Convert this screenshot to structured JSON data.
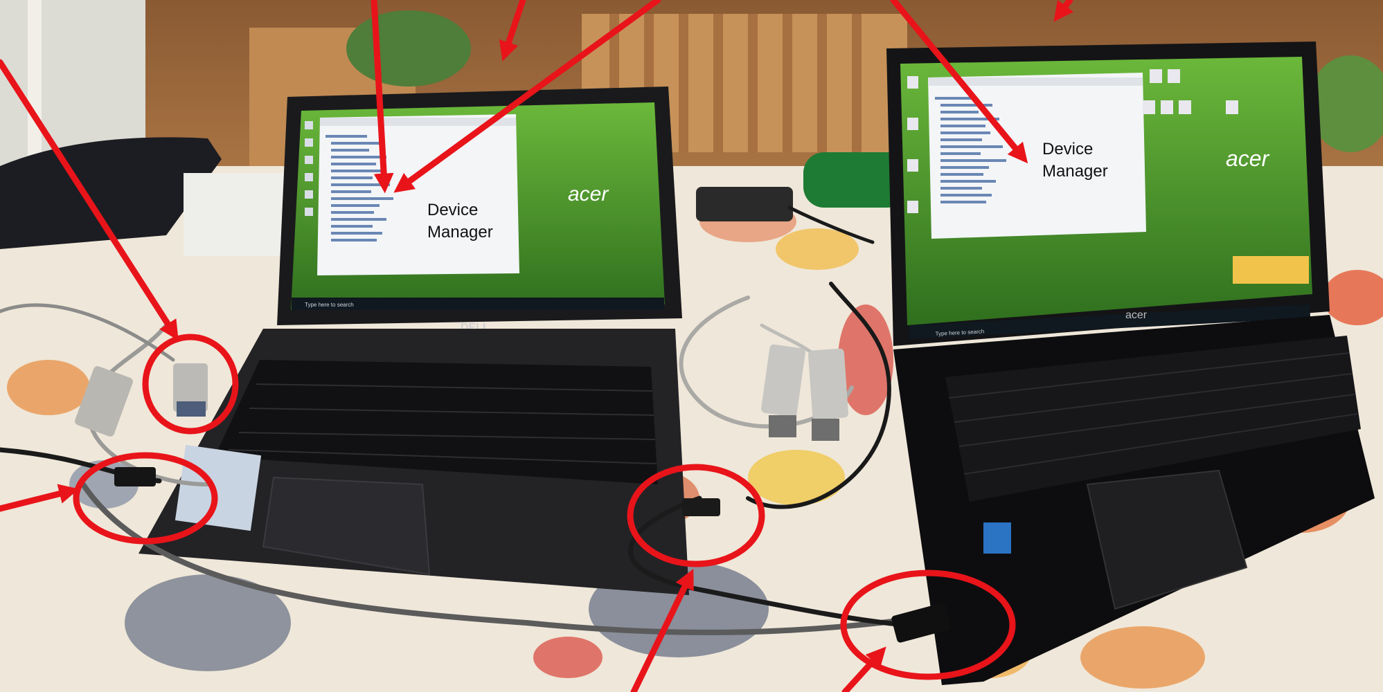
{
  "annotations": {
    "left_label": [
      "Device",
      "Manager"
    ],
    "right_label": [
      "Device",
      "Manager"
    ]
  },
  "laptops": {
    "left_brand_screen": "acer",
    "left_bezel_brand": "DELL",
    "right_brand_screen": "acer",
    "right_bezel_brand": "acer",
    "left_taskbar_search": "Type here to search",
    "right_taskbar_search": "Type here to search"
  },
  "colors": {
    "annotation": "#e8141a",
    "table_base": "#efe7d9"
  }
}
